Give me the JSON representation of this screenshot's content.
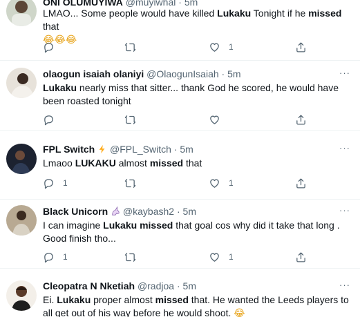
{
  "tweets": [
    {
      "name": "ONI OLUMUYIWA",
      "handle": "@muyiwhal",
      "time": "5m",
      "text_parts": [
        "LMAO... Some people would have killed ",
        "Lukaku",
        " Tonight if he ",
        "missed",
        " that"
      ],
      "emoji": "😂😂😂",
      "reply_count": "",
      "rt_count": "",
      "like_count": "1"
    },
    {
      "name": "olaogun isaiah olaniyi",
      "handle": "@OlaogunIsaiah",
      "time": "5m",
      "text_parts": [
        "Lukaku",
        " nearly miss that sitter... thank God he scored, he would have been roasted tonight"
      ],
      "reply_count": "",
      "rt_count": "",
      "like_count": ""
    },
    {
      "name": "FPL Switch",
      "handle": "@FPL_Switch",
      "time": "5m",
      "text_parts": [
        "Lmaoo ",
        "LUKAKU",
        " almost ",
        "missed",
        " that"
      ],
      "reply_count": "1",
      "rt_count": "",
      "like_count": "1"
    },
    {
      "name": "Black Unicorn",
      "handle": "@kaybash2",
      "time": "5m",
      "text_parts": [
        "I can imagine ",
        "Lukaku",
        " ",
        "missed",
        " that goal cos why did it take that long . Good finish tho..."
      ],
      "reply_count": "1",
      "rt_count": "",
      "like_count": "1"
    },
    {
      "name": "Cleopatra N Nketiah",
      "handle": "@radjoa",
      "time": "5m",
      "text_parts": [
        "Ei. ",
        "Lukaku",
        " proper almost ",
        "missed",
        " that. He wanted the Leeds players to all get out of his way before he would shoot. "
      ],
      "emoji": "😂"
    }
  ],
  "separator": "·",
  "more_label": "···",
  "icons": {
    "reply": "reply-icon",
    "retweet": "retweet-icon",
    "like": "like-icon",
    "share": "share-icon",
    "lightning": "lightning-icon",
    "unicorn": "unicorn-icon"
  },
  "colors": {
    "text": "#0f1419",
    "secondary": "#536471",
    "border": "#eff3f4",
    "lightning": "#ffad1f"
  }
}
